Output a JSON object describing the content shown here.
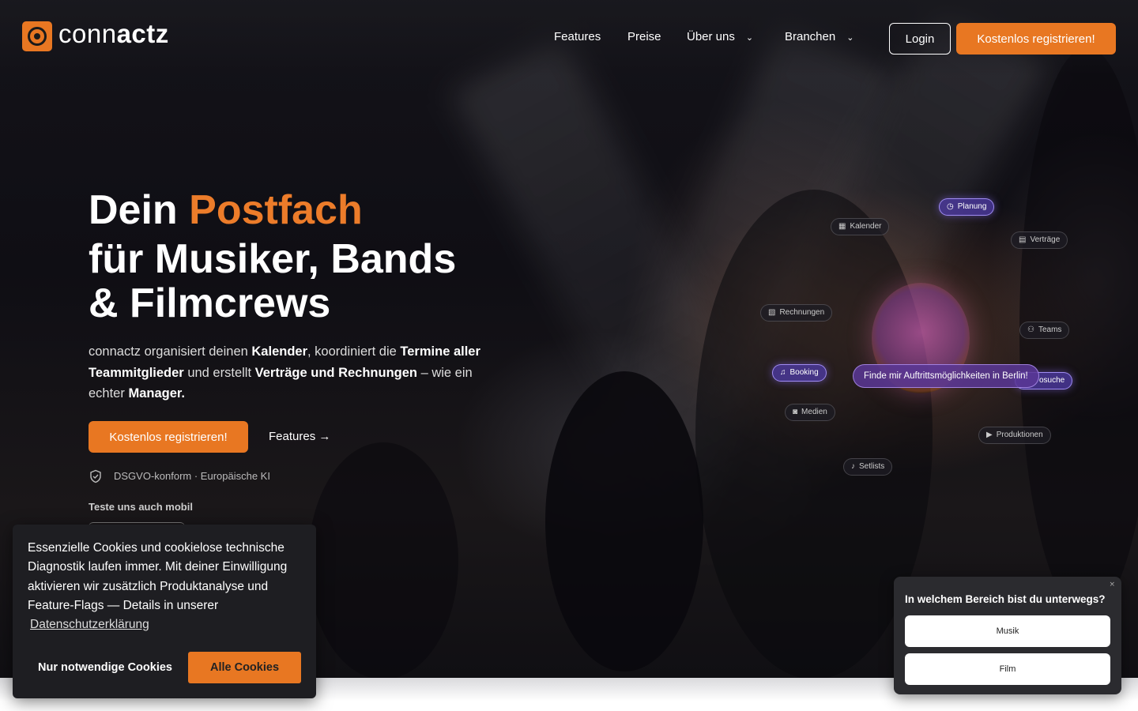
{
  "brand": {
    "name_light": "conn",
    "name_bold": "actz",
    "accent_color": "#e87722"
  },
  "nav": {
    "links": [
      {
        "label": "Features"
      },
      {
        "label": "Preise"
      },
      {
        "label": "Über uns",
        "has_dropdown": true
      },
      {
        "label": "Branchen",
        "has_dropdown": true
      }
    ],
    "login_label": "Login",
    "register_label": "Kostenlos registrieren!"
  },
  "hero": {
    "title_part1": "Dein ",
    "title_accent": "Postfach",
    "title_line2": "für Musiker, Bands",
    "title_line3": "& Filmcrews",
    "lead": {
      "t1": "connactz organisiert deinen ",
      "b1": "Kalender",
      "t2": ", koordiniert die ",
      "b2": "Termine aller Teammitglieder",
      "t3": " und erstellt ",
      "b3": "Verträge und Rechnungen",
      "t4": " – wie ein echter ",
      "b4": "Manager."
    },
    "cta_label": "Kostenlos registrieren!",
    "features_link": "Features",
    "arrow_glyph": "→",
    "gdpr_note": "DSGVO-konform · Europäische KI",
    "mobile_note": "Teste uns auch mobil"
  },
  "feature_chips": [
    {
      "label": "Planung",
      "icon": "clock-icon",
      "highlight": true
    },
    {
      "label": "Kalender",
      "icon": "calendar-icon",
      "highlight": false
    },
    {
      "label": "Verträge",
      "icon": "document-icon",
      "highlight": false
    },
    {
      "label": "Rechnungen",
      "icon": "invoice-icon",
      "highlight": false
    },
    {
      "label": "Teams",
      "icon": "users-icon",
      "highlight": false
    },
    {
      "label": "Booking",
      "icon": "music-note-icon",
      "highlight": true
    },
    {
      "label": "osuche",
      "icon": "search-icon",
      "highlight": true
    },
    {
      "label": "Medien",
      "icon": "camera-icon",
      "highlight": false
    },
    {
      "label": "Produktionen",
      "icon": "video-icon",
      "highlight": false
    },
    {
      "label": "Setlists",
      "icon": "music-note-icon",
      "highlight": false
    }
  ],
  "ai_prompt": "Finde mir Auftrittsmöglichkeiten in Berlin!",
  "cookie_banner": {
    "text": "Essenzielle Cookies und cookielose technische Diagnostik laufen immer. Mit deiner Einwilligung aktivieren wir zusätzlich Produktanalyse und Feature-Flags — Details in unserer",
    "link_label": "Datenschutzerklärung",
    "necessary_label": "Nur notwendige Cookies",
    "all_label": "Alle Cookies"
  },
  "survey": {
    "close_glyph": "×",
    "question": "In welchem Bereich bist du unterwegs?",
    "options": [
      "Musik",
      "Film"
    ]
  }
}
